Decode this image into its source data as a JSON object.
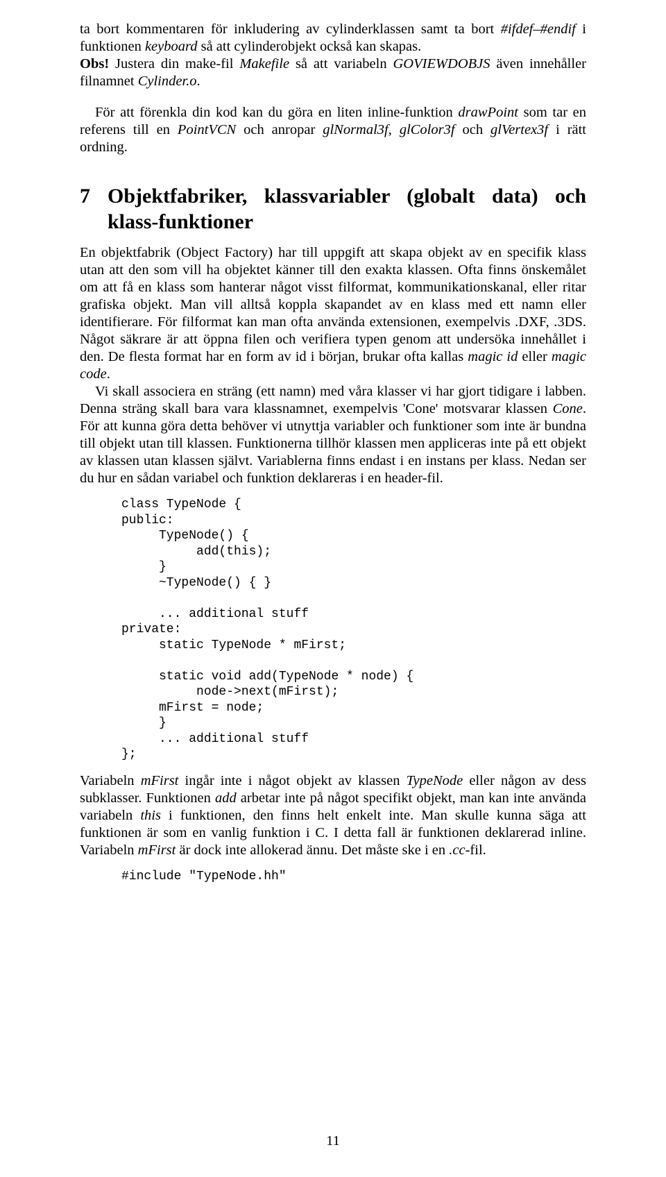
{
  "para1_a": "ta bort kommentaren för inkludering av cylinderklassen samt ta bort ",
  "para1_b": "#ifdef–#endif",
  "para1_c": " i funktionen ",
  "para1_d": "keyboard",
  "para1_e": " så att cylinderobjekt också kan skapas.",
  "para2_a": "Obs!",
  "para2_b": " Justera din make-fil ",
  "para2_c": "Makefile",
  "para2_d": " så att variabeln ",
  "para2_e": "GOVIEWDOBJS",
  "para2_f": " även innehåller filnamnet ",
  "para2_g": "Cylinder.o",
  "para2_h": ".",
  "para3_a": "För att förenkla din kod kan du göra en liten inline-funktion ",
  "para3_b": "drawPoint",
  "para3_c": " som tar en referens till en ",
  "para3_d": "PointVCN",
  "para3_e": " och anropar ",
  "para3_f": "glNormal3f",
  "para3_g": ", ",
  "para3_h": "glColor3f",
  "para3_i": " och ",
  "para3_j": "glVertex3f",
  "para3_k": " i rätt ordning.",
  "section_num": "7",
  "section_title": "Objektfabriker, klassvariabler (globalt data) och klass-funktioner",
  "para4_a": "En objektfabrik (Object Factory) har till uppgift att skapa objekt av en specifik klass utan att den som vill ha objektet känner till den exakta klassen. Ofta finns önskemålet om att få en klass som hanterar något visst filformat, kommunikationskanal, eller ritar grafiska objekt. Man vill alltså koppla skapandet av en klass med ett namn eller identifierare. För filformat kan man ofta använda extensionen, exempelvis .DXF, .3DS. Något säkrare är att öppna filen och verifiera typen genom att undersöka innehållet i den. De flesta format har en form av id i början, brukar ofta kallas ",
  "para4_b": "magic id",
  "para4_c": " eller ",
  "para4_d": "magic code",
  "para4_e": ".",
  "para5_a": "Vi skall associera en sträng (ett namn) med våra klasser vi har gjort tidigare i labben. Denna sträng skall bara vara klassnamnet, exempelvis 'Cone' motsvarar klassen ",
  "para5_b": "Cone",
  "para5_c": ". För att kunna göra detta behöver vi utnyttja variabler och funktioner som inte är bundna till objekt utan till klassen. Funktionerna tillhör klassen men appliceras inte på ett objekt av klassen utan klassen självt. Variablerna finns endast i en instans per klass. Nedan ser du hur en sådan variabel och funktion deklareras i en header-fil.",
  "code1": "class TypeNode {\npublic:\n     TypeNode() {\n          add(this);\n     }\n     ~TypeNode() { }\n\n     ... additional stuff\nprivate:\n     static TypeNode * mFirst;\n\n     static void add(TypeNode * node) {\n          node->next(mFirst);\n     mFirst = node;\n     }\n     ... additional stuff\n};",
  "para6_a": "Variabeln ",
  "para6_b": "mFirst",
  "para6_c": " ingår inte i något objekt av klassen ",
  "para6_d": "TypeNode",
  "para6_e": " eller någon av dess subklasser. Funktionen ",
  "para6_f": "add",
  "para6_g": " arbetar inte på något specifikt objekt, man kan inte använda variabeln ",
  "para6_h": "this",
  "para6_i": " i funktionen, den finns helt enkelt inte. Man skulle kunna säga att funktionen är som en vanlig funktion i C. I detta fall är funktionen deklarerad inline. Variabeln ",
  "para6_j": "mFirst",
  "para6_k": " är dock inte allokerad ännu. Det måste ske i en ",
  "para6_l": ".cc",
  "para6_m": "-fil.",
  "code2": "#include \"TypeNode.hh\"",
  "pagenum": "11"
}
